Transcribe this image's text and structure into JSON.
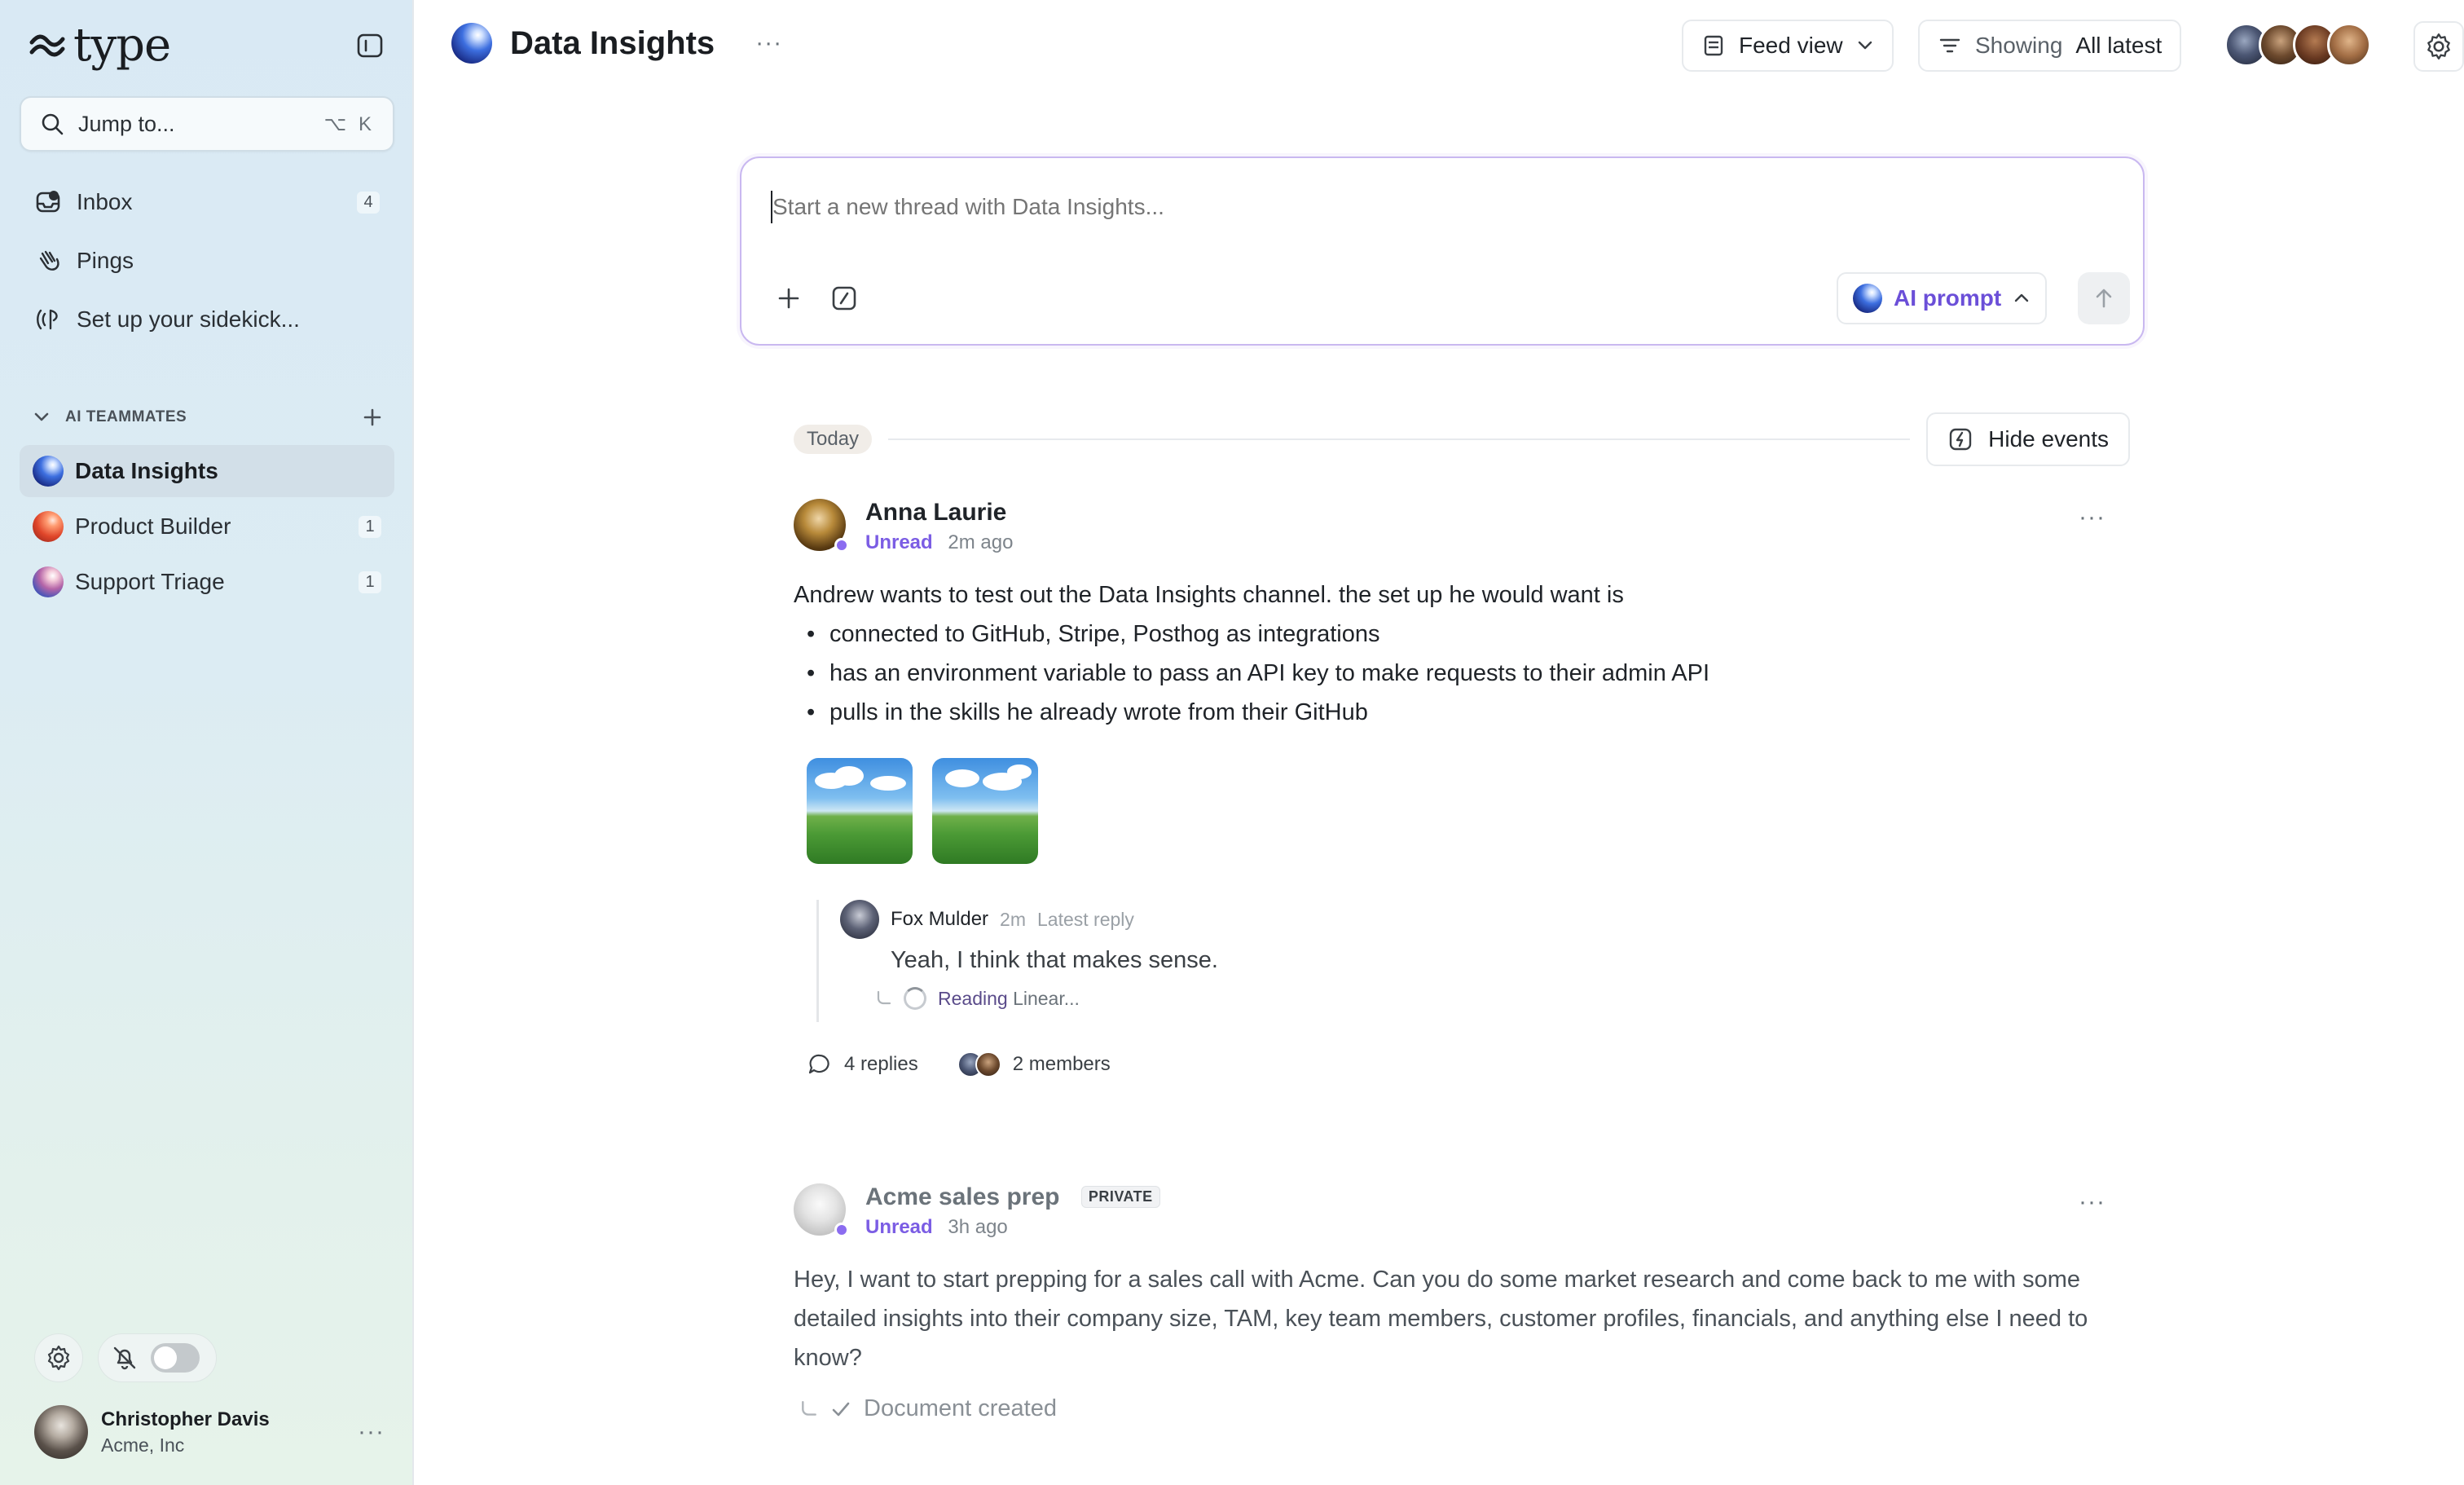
{
  "app": {
    "brand": "type"
  },
  "sidebar": {
    "jump_placeholder": "Jump to...",
    "jump_shortcut": "⌥ K",
    "nav": [
      {
        "label": "Inbox",
        "count": "4",
        "icon": "inbox-icon"
      },
      {
        "label": "Pings",
        "icon": "wave-hand-icon"
      },
      {
        "label": "Set up your sidekick...",
        "icon": "sidekick-icon"
      }
    ],
    "section_title": "AI TEAMMATES",
    "teammates": [
      {
        "label": "Data Insights",
        "active": true
      },
      {
        "label": "Product Builder",
        "count": "1"
      },
      {
        "label": "Support Triage",
        "count": "1"
      }
    ],
    "user": {
      "name": "Christopher Davis",
      "org": "Acme, Inc"
    }
  },
  "header": {
    "title": "Data Insights",
    "feed_view_label": "Feed view",
    "showing_label": "Showing",
    "showing_value": "All latest"
  },
  "composer": {
    "placeholder": "Start a new thread with Data Insights...",
    "ai_prompt_label": "AI prompt"
  },
  "feed": {
    "today_label": "Today",
    "hide_events_label": "Hide events",
    "threads": [
      {
        "author": "Anna Laurie",
        "status": "Unread",
        "time": "2m ago",
        "intro": "Andrew wants to test out the Data Insights channel. the set up he would want is",
        "bullets": [
          "connected to GitHub, Stripe, Posthog as integrations",
          "has an environment variable to pass an API key to make requests to their admin API",
          "pulls in the skills he already wrote from their GitHub"
        ],
        "reply": {
          "author": "Fox Mulder",
          "time": "2m",
          "tag": "Latest reply",
          "text": "Yeah, I think that makes sense.",
          "status_strong": "Reading",
          "status_rest": " Linear..."
        },
        "replies_label": "4 replies",
        "members_label": "2 members"
      },
      {
        "author": "Acme sales prep",
        "badge": "PRIVATE",
        "status": "Unread",
        "time": "3h ago",
        "body": "Hey, I want to start prepping for a sales call with Acme. Can you do some market research and come back to me with some detailed insights into their company size, TAM, key team members, customer profiles, financials, and anything else I need to know?",
        "event": "Document created"
      }
    ]
  },
  "colors": {
    "accent": "#7b5de4",
    "sidebar_active": "#d2dfe8"
  }
}
